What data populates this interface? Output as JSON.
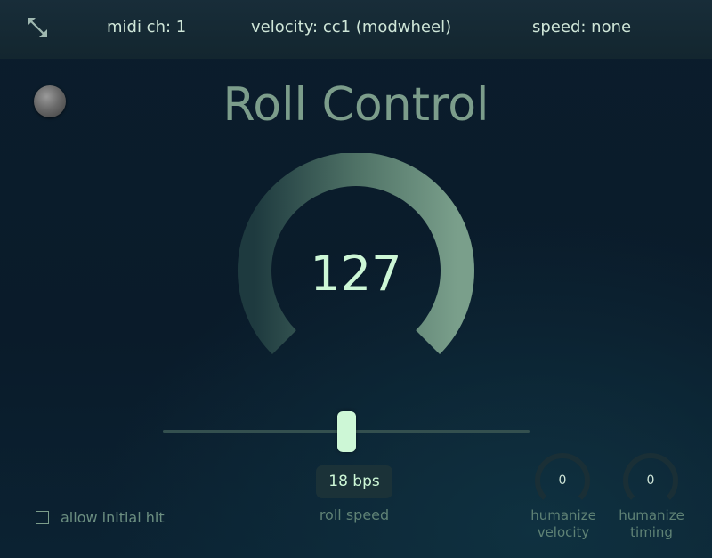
{
  "header": {
    "midi_channel": "midi ch: 1",
    "velocity": "velocity: cc1 (modwheel)",
    "speed": "speed: none"
  },
  "title": "Roll Control",
  "main_knob": {
    "value": "127",
    "level": 1.0
  },
  "roll_speed": {
    "value": "18 bps",
    "label": "roll speed",
    "position": 0.5
  },
  "allow_initial_hit": {
    "label": "allow initial hit",
    "checked": false
  },
  "humanize_velocity": {
    "value": "0",
    "label_line1": "humanize",
    "label_line2": "velocity"
  },
  "humanize_timing": {
    "value": "0",
    "label_line1": "humanize",
    "label_line2": "timing"
  },
  "colors": {
    "accent": "#cdf7d6",
    "arc_end": "#7a9f8b",
    "background": "#0a1c2b",
    "header_bg": "#152a34"
  },
  "icons": {
    "expand": "expand-arrows-icon",
    "power": "power-led-icon"
  }
}
